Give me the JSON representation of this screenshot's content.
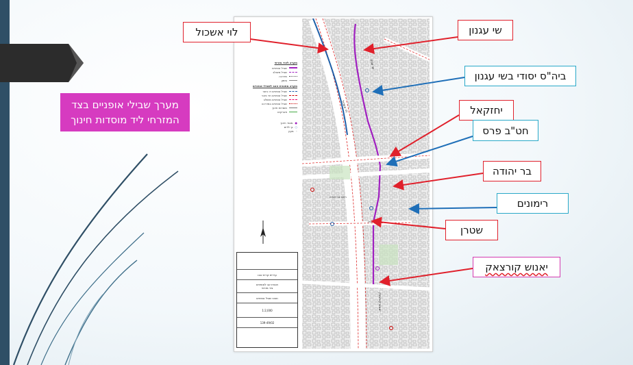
{
  "slide": {
    "main_note": {
      "line1": "מערך שבילי אופניים בצד",
      "line2": "המזרחי ליד מוסדות חינוך"
    },
    "callouts": [
      {
        "id": "levi-eshkol",
        "label": "לוי אשכול",
        "style": "red"
      },
      {
        "id": "shai-agnon",
        "label": "שי עגנון",
        "style": "red"
      },
      {
        "id": "school-shai-agnon",
        "label": "ביה\"ס יסודי בשי עגנון",
        "style": "blue"
      },
      {
        "id": "yehezkel",
        "label": "יחזקאל",
        "style": "red"
      },
      {
        "id": "hatav-pras",
        "label": "חט\"ב פרס",
        "style": "blue"
      },
      {
        "id": "bar-yehuda",
        "label": "בר יהודה",
        "style": "red"
      },
      {
        "id": "rimonim",
        "label": "רימונים",
        "style": "blue"
      },
      {
        "id": "shteren",
        "label": "שטרן",
        "style": "red"
      },
      {
        "id": "janusz-korczak",
        "label": "יאנוש קורצאק",
        "style": "pink"
      }
    ],
    "colors": {
      "red": "#e0202b",
      "blue": "#28a8c8",
      "pink": "#d63bc0",
      "navy_bar": "#2f4f66",
      "map_route_purple": "#a020c0",
      "map_route_blue": "#1f5fa8"
    }
  },
  "map": {
    "legend": {
      "title1": "מקרא לציר מזרחי",
      "items1": [
        "שביל אופניים",
        "שביל משולב",
        "מדרכה",
        "סימון"
      ],
      "title2": "מקרא מתכנית האב לשבילי אופניים",
      "items2": [
        "שביל אופניים דו כיווני",
        "שביל אופניים חד כיווני",
        "שביל אופניים משולב",
        "שביל אופניים במדרכה",
        "מוסדות חינוך",
        "פארקים"
      ],
      "items3": [
        "מוסד חינוך",
        "גן ילדים",
        "מעון"
      ]
    },
    "street_labels": [
      "לוי אשכול",
      "שי עגנון",
      "רחוב שטרן",
      "רחוב בר יהודה",
      "יאנוש קורצאק"
    ],
    "title_block": {
      "company": "עיריית קרית אונו",
      "project": "תכנית אב לאופניים",
      "subject": "ציר מזרחי",
      "drawing": "תוואי שביל אופניים",
      "scale": "1:2,000",
      "number": "139-49/02"
    }
  }
}
